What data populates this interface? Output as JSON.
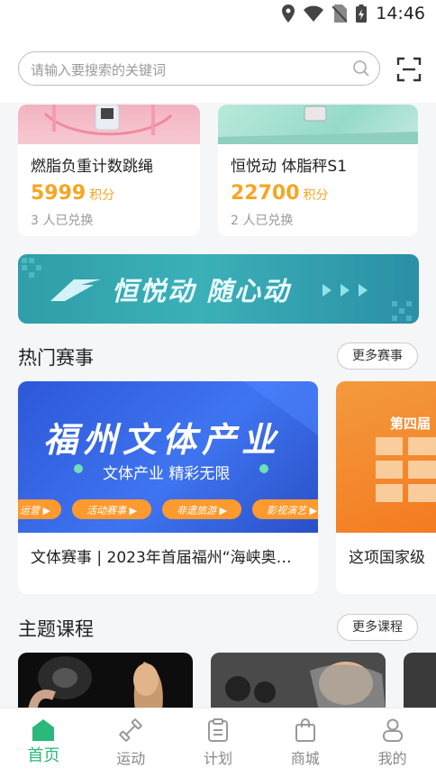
{
  "status_bar": {
    "time": "14:46"
  },
  "search": {
    "placeholder": "请输入要搜索的关键词"
  },
  "products": [
    {
      "name": "燃脂负重计数跳绳",
      "price": "5999",
      "unit": "积分",
      "redeemed": "3 人已兑换"
    },
    {
      "name": "恒悦动  体脂秤S1",
      "price": "22700",
      "unit": "积分",
      "redeemed": "2 人已兑换"
    }
  ],
  "banner": {
    "text": "恒悦动  随心动"
  },
  "hot_events": {
    "title": "热门赛事",
    "more_label": "更多赛事",
    "items": [
      {
        "title": "文体赛事 | 2023年首届福州“海峡奥…",
        "image_headline": "福州文体产业",
        "image_subline": "文体产业 精彩无限",
        "image_tags": [
          "运营 ▶",
          "活动赛事 ▶",
          "非遗旅游 ▶",
          "影视演艺 ▶"
        ]
      },
      {
        "title": "这项国家级",
        "image_headline": "第四届"
      }
    ]
  },
  "courses": {
    "title": "主题课程",
    "more_label": "更多课程"
  },
  "tabs": [
    {
      "label": "首页",
      "icon": "home-icon",
      "active": true
    },
    {
      "label": "运动",
      "icon": "dumbbell-icon",
      "active": false
    },
    {
      "label": "计划",
      "icon": "clipboard-icon",
      "active": false
    },
    {
      "label": "商城",
      "icon": "shopping-bag-icon",
      "active": false
    },
    {
      "label": "我的",
      "icon": "user-icon",
      "active": false
    }
  ],
  "colors": {
    "accent": "#2bb87a",
    "price": "#f5a623",
    "banner": "#3bb0b8"
  }
}
